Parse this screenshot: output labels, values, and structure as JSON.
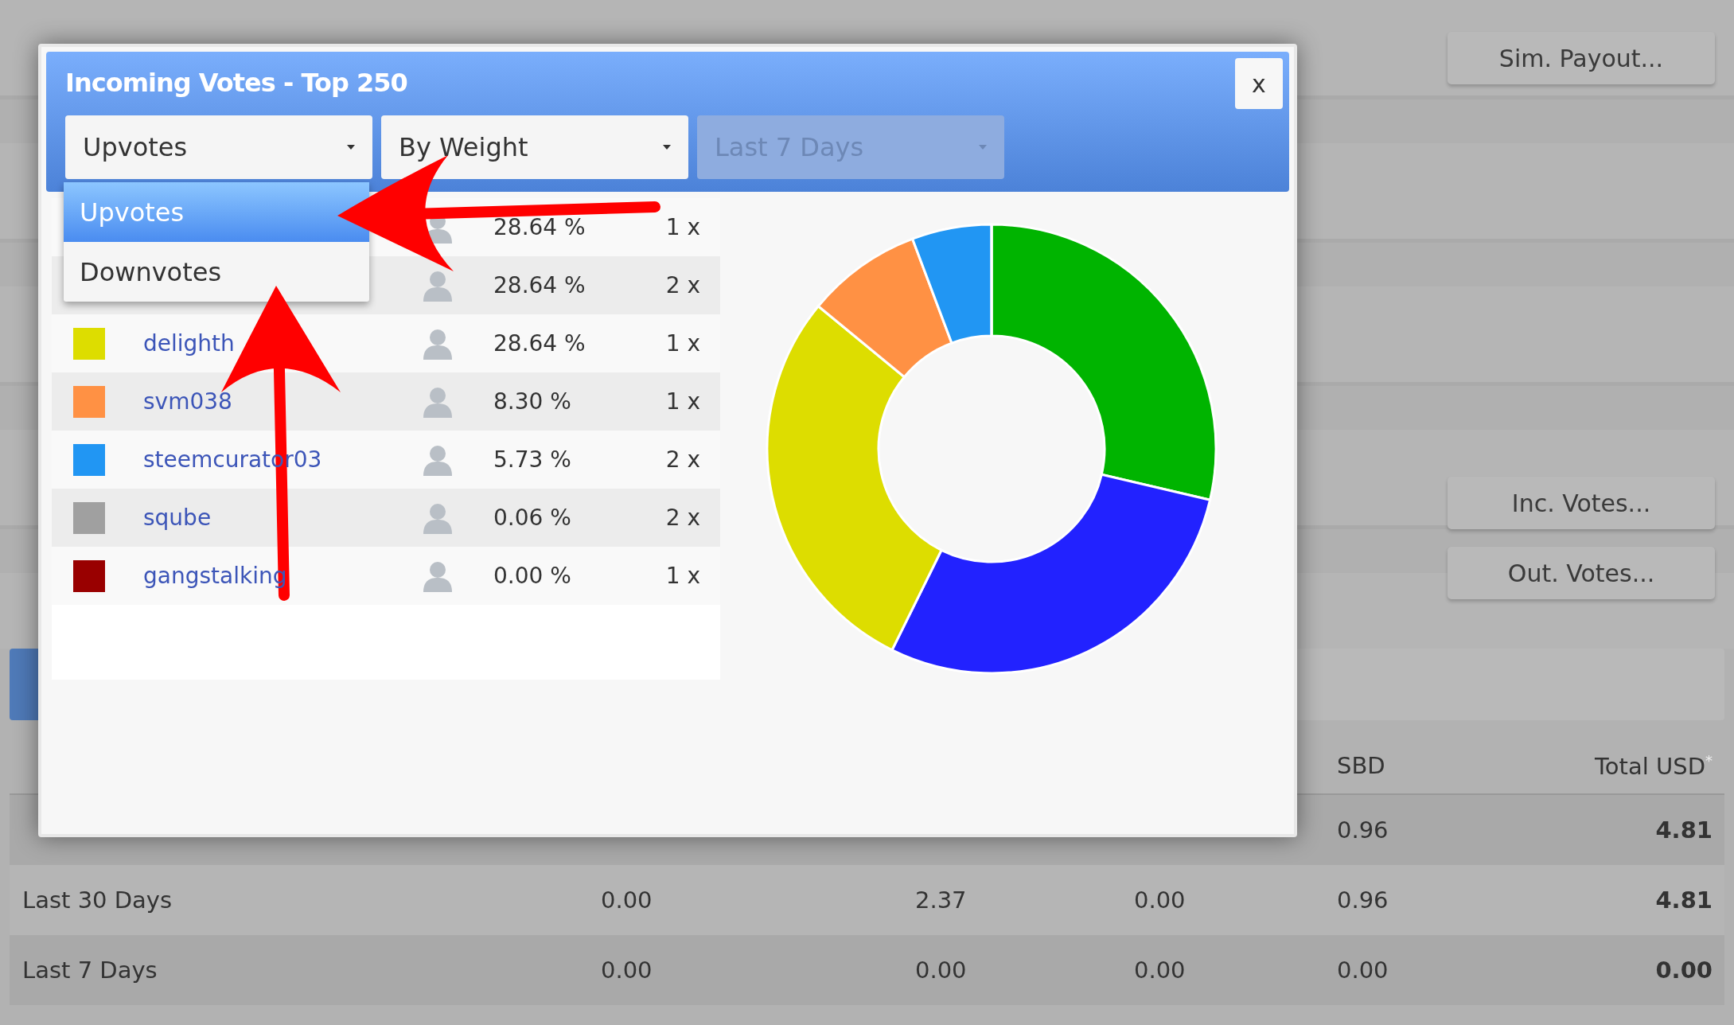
{
  "modal": {
    "title": "Incoming Votes - Top 250",
    "close": "x",
    "dropdowns": [
      {
        "label": "Upvotes",
        "disabled": false
      },
      {
        "label": "By Weight",
        "disabled": false
      },
      {
        "label": "Last 7 Days",
        "disabled": true
      }
    ],
    "menu": [
      {
        "label": "Upvotes",
        "selected": true
      },
      {
        "label": "Downvotes",
        "selected": false
      }
    ],
    "rows": [
      {
        "percent": "28.64 %",
        "count": "1 x"
      },
      {
        "percent": "28.64 %",
        "count": "2 x"
      },
      {
        "color": "#dddd00",
        "name": "delighth",
        "percent": "28.64 %",
        "count": "1 x"
      },
      {
        "color": "#ff9144",
        "name": "svm038",
        "percent": "8.30 %",
        "count": "1 x"
      },
      {
        "color": "#2196f3",
        "name": "steemcurator03",
        "percent": "5.73 %",
        "count": "2 x"
      },
      {
        "color": "#a0a0a0",
        "name": "sqube",
        "percent": "0.06 %",
        "count": "2 x"
      },
      {
        "color": "#990000",
        "name": "gangstalking",
        "percent": "0.00 %",
        "count": "1 x"
      }
    ],
    "chart_data": {
      "type": "donut",
      "values": [
        28.64,
        28.64,
        28.64,
        8.3,
        5.73,
        null,
        0.0
      ],
      "colors": [
        "#00b400",
        "#2222ff",
        "#dddd00",
        "#ff9144",
        "#2196f3",
        null,
        "#990000"
      ]
    }
  },
  "side_buttons": [
    "Sim. Payout...",
    "Inc. Votes...",
    "Out. Votes..."
  ],
  "summary": {
    "columns": [
      "SBD",
      "Total USD$^{*}$"
    ],
    "rows": [
      {
        "sbd": "0.96",
        "total": "4.81"
      },
      {
        "label": "Last 30 Days",
        "column_2": "0.00",
        "column_3": "2.37",
        "column_4": "0.00",
        "sbd": "0.96",
        "total": "4.81"
      },
      {
        "label": "Last 7 Days",
        "column_2": "0.00",
        "column_3": "0.00",
        "column_4": "0.00",
        "sbd": "0.00",
        "total": "0.00"
      }
    ]
  }
}
